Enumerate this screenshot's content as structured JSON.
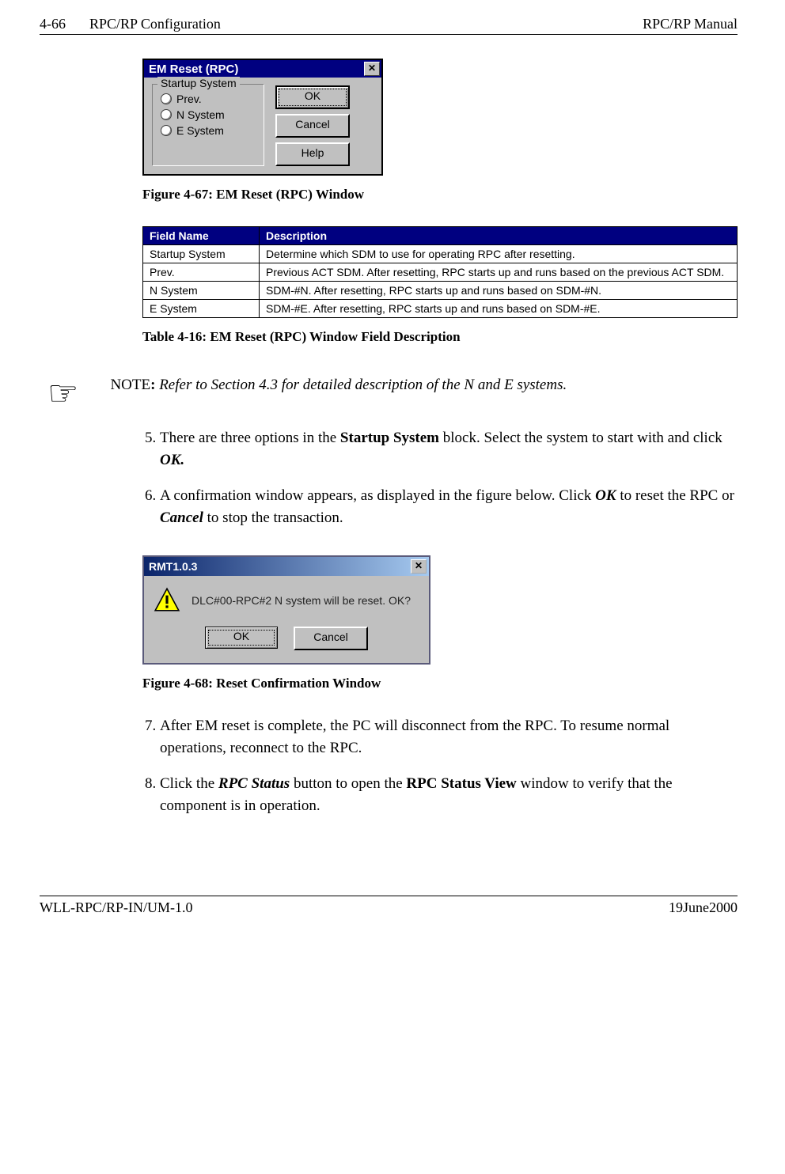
{
  "header": {
    "page_num": "4-66",
    "section": "RPC/RP Configuration",
    "manual": "RPC/RP Manual"
  },
  "fig1": {
    "window_title": "EM Reset (RPC)",
    "close_glyph": "✕",
    "group_legend": "Startup System",
    "radios": {
      "prev": "Prev.",
      "n": "N System",
      "e": "E System"
    },
    "buttons": {
      "ok": "OK",
      "cancel": "Cancel",
      "help": "Help"
    },
    "caption": "Figure 4-67: EM Reset (RPC) Window"
  },
  "table": {
    "head": {
      "field": "Field Name",
      "desc": "Description"
    },
    "rows": [
      {
        "field": "Startup System",
        "desc": "Determine which SDM to use for operating RPC after resetting."
      },
      {
        "field": "Prev.",
        "desc": "Previous ACT SDM.  After resetting, RPC starts up and runs based on the previous ACT SDM."
      },
      {
        "field": "N System",
        "desc": "SDM-#N.  After resetting, RPC starts up and runs based on SDM-#N."
      },
      {
        "field": "E System",
        "desc": "SDM-#E.  After resetting, RPC starts up and runs based on SDM-#E."
      }
    ],
    "caption": "Table 4-16: EM Reset (RPC) Window Field Description"
  },
  "note": {
    "hand_glyph": "☞",
    "label": "NOTE",
    "text": "Refer to Section 4.3 for detailed description of the N and E systems."
  },
  "steps_a": {
    "s5_pre": "There are three options in the ",
    "s5_bold": "Startup System",
    "s5_mid": " block.  Select the system to start with and click ",
    "s5_ok": "OK.",
    "s6_pre": "A confirmation window appears, as displayed in the figure below.  Click ",
    "s6_ok": "OK",
    "s6_mid": " to reset the RPC or ",
    "s6_cancel": "Cancel",
    "s6_post": " to stop the transaction."
  },
  "fig2": {
    "window_title": "RMT1.0.3",
    "close_glyph": "✕",
    "message": "DLC#00-RPC#2 N system will be reset. OK?",
    "ok_label": "OK",
    "cancel_label": "Cancel",
    "caption": "Figure 4-68: Reset Confirmation Window"
  },
  "steps_b": {
    "s7": "After EM reset is complete, the PC will disconnect from the RPC.  To resume normal operations, reconnect to the RPC.",
    "s8_pre": "Click the ",
    "s8_btn": "RPC Status",
    "s8_mid": " button to open the ",
    "s8_win": "RPC Status View",
    "s8_post": " window to verify that the component is in operation."
  },
  "footer": {
    "doc_id": "WLL-RPC/RP-IN/UM-1.0",
    "date": "19June2000"
  }
}
